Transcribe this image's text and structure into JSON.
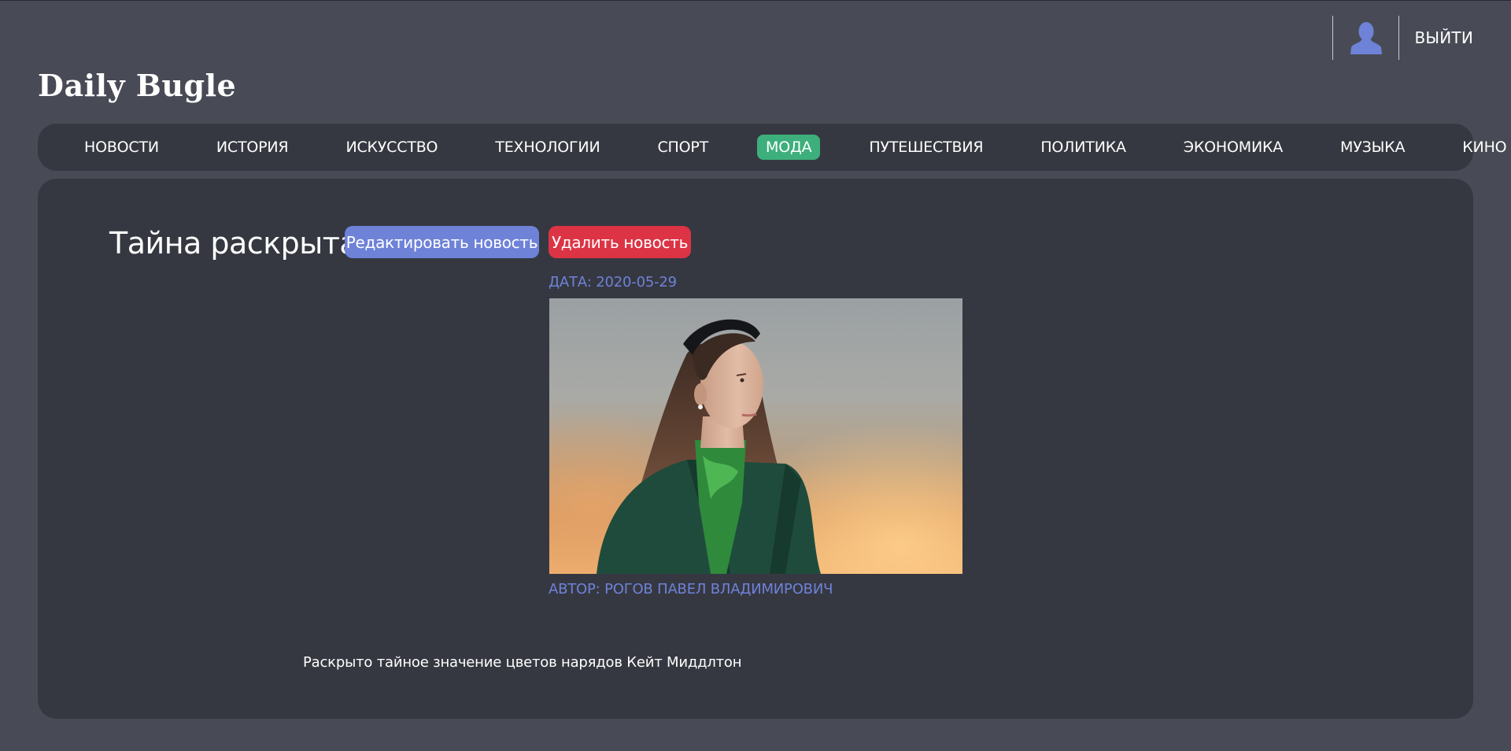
{
  "site": {
    "logo": "Daily Bugle"
  },
  "user": {
    "avatar_icon": "user-silhouette-icon",
    "logout_label": "ВЫЙТИ"
  },
  "nav": {
    "items": [
      {
        "label": "НОВОСТИ"
      },
      {
        "label": "ИСТОРИЯ"
      },
      {
        "label": "ИСКУССТВО"
      },
      {
        "label": "ТЕХНОЛОГИИ"
      },
      {
        "label": "СПОРТ"
      },
      {
        "label": "МОДА",
        "active": true
      },
      {
        "label": "ПУТЕШЕСТВИЯ"
      },
      {
        "label": "ПОЛИТИКА"
      },
      {
        "label": "ЭКОНОМИКА"
      },
      {
        "label": "МУЗЫКА"
      },
      {
        "label": "КИНО"
      }
    ]
  },
  "article": {
    "title": "Тайна раскрыта!",
    "edit_label": "Редактировать новость",
    "delete_label": "Удалить новость",
    "date": "ДАТА: 2020-05-29",
    "author": "АВТОР: РОГОВ ПАВЕЛ ВЛАДИМИРОВИЧ",
    "summary": "Раскрыто тайное значение цветов нарядов Кейт Миддлтон"
  },
  "colors": {
    "page_bg": "#484b55",
    "panel_bg": "#363841",
    "accent_blue": "#6e82d8",
    "active_green": "#3daf7c",
    "danger_red": "#dc3445"
  }
}
